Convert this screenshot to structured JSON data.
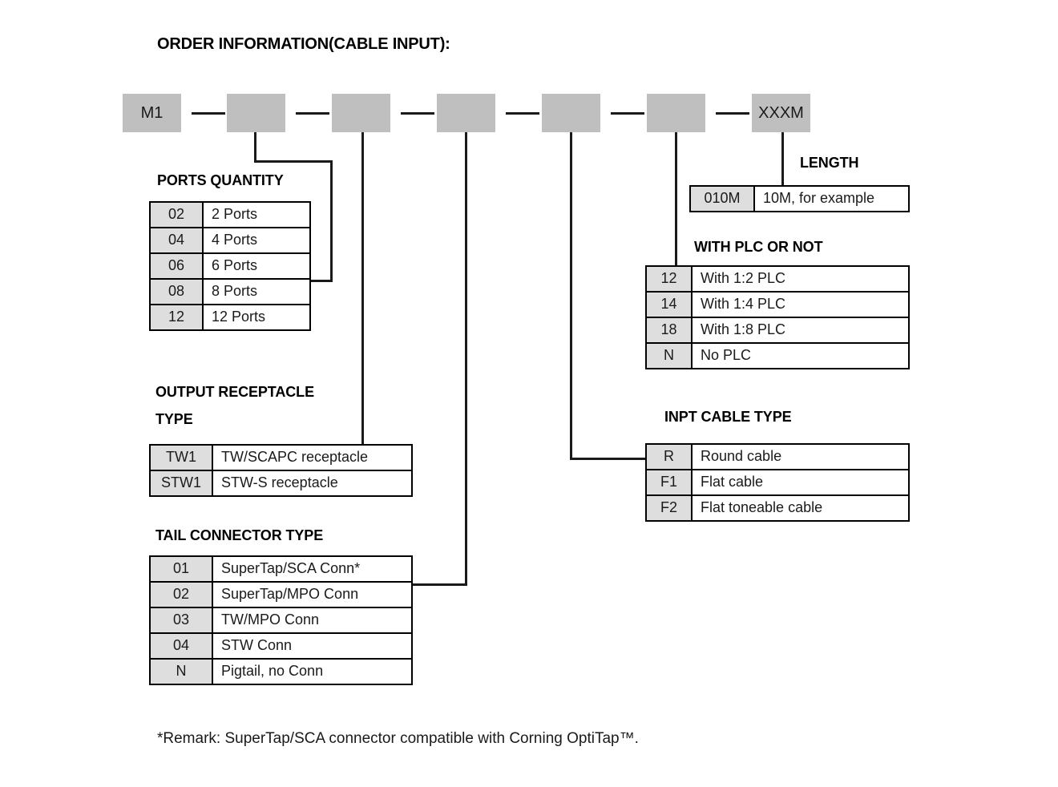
{
  "title": "ORDER INFORMATION(CABLE INPUT):",
  "flow": {
    "boxes": [
      {
        "label": "M1"
      },
      {
        "label": ""
      },
      {
        "label": ""
      },
      {
        "label": ""
      },
      {
        "label": ""
      },
      {
        "label": ""
      },
      {
        "label": "XXXM"
      }
    ]
  },
  "sections": {
    "ports_quantity": {
      "caption": "PORTS QUANTITY",
      "rows": [
        {
          "code": "02",
          "value": "2 Ports"
        },
        {
          "code": "04",
          "value": "4 Ports"
        },
        {
          "code": "06",
          "value": "6 Ports"
        },
        {
          "code": "08",
          "value": "8 Ports"
        },
        {
          "code": "12",
          "value": "12 Ports"
        }
      ]
    },
    "output_receptacle_type": {
      "caption_line1": "OUTPUT RECEPTACLE",
      "caption_line2": "TYPE",
      "rows": [
        {
          "code": "TW1",
          "value": "TW/SCAPC receptacle"
        },
        {
          "code": "STW1",
          "value": "STW-S receptacle"
        }
      ]
    },
    "tail_connector_type": {
      "caption": "TAIL CONNECTOR TYPE",
      "rows": [
        {
          "code": "01",
          "value": "SuperTap/SCA Conn*"
        },
        {
          "code": "02",
          "value": "SuperTap/MPO Conn"
        },
        {
          "code": "03",
          "value": "TW/MPO Conn"
        },
        {
          "code": "04",
          "value": "STW Conn"
        },
        {
          "code": "N",
          "value": "Pigtail, no Conn"
        }
      ]
    },
    "length": {
      "caption": "LENGTH",
      "rows": [
        {
          "code": "010M",
          "value": "10M, for example"
        }
      ]
    },
    "with_plc_or_not": {
      "caption": "WITH PLC OR NOT",
      "rows": [
        {
          "code": "12",
          "value": "With 1:2 PLC"
        },
        {
          "code": "14",
          "value": "With 1:4 PLC"
        },
        {
          "code": "18",
          "value": "With 1:8 PLC"
        },
        {
          "code": "N",
          "value": "No PLC"
        }
      ]
    },
    "input_cable_type": {
      "caption": "INPT CABLE TYPE",
      "rows": [
        {
          "code": "R",
          "value": "Round cable"
        },
        {
          "code": "F1",
          "value": "Flat cable"
        },
        {
          "code": "F2",
          "value": "Flat toneable cable"
        }
      ]
    }
  },
  "remark": "*Remark: SuperTap/SCA connector compatible with Corning OptiTap™."
}
